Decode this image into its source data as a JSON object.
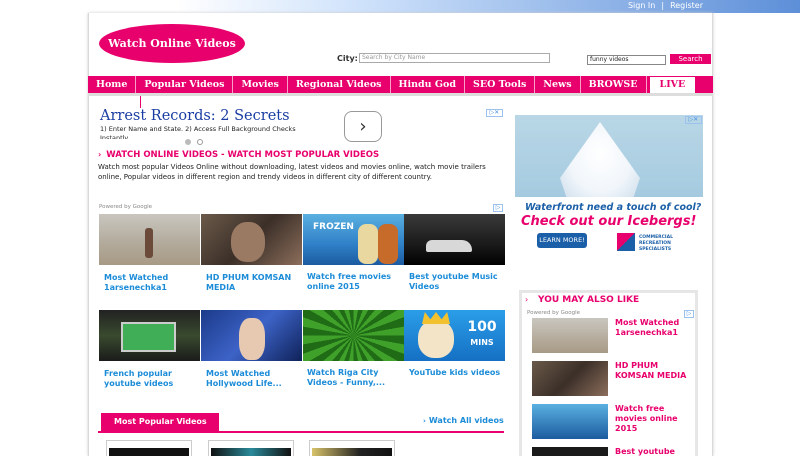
{
  "header": {
    "sign_in": "Sign In",
    "separator": "|",
    "register": "Register",
    "logo_text": "Watch Online Videos",
    "city_label": "City:",
    "city_placeholder": "Search by City Name",
    "search_value": "funny videos",
    "search_button": "Search"
  },
  "nav": {
    "items": [
      "Home",
      "Popular Videos",
      "Movies",
      "Regional Videos",
      "Hindu God",
      "SEO Tools",
      "News",
      "BROWSE"
    ],
    "live": "LIVE"
  },
  "ad_top": {
    "title": "Arrest Records: 2 Secrets",
    "text": "1) Enter Name and State. 2) Access Full Background Checks Instantly.",
    "arrow": "›"
  },
  "main": {
    "section_title": "WATCH ONLINE VIDEOS - WATCH MOST POPULAR VIDEOS",
    "caret": "›",
    "description": "Watch most popular Videos Online without downloading, latest videos and movies online, watch movie trailers online, Popular videos in different region and trendy videos in different city of different country.",
    "powered_by": "Powered by Google",
    "videos": [
      {
        "title": "Most Watched 1arsenechka1"
      },
      {
        "title": "HD PHUM KOMSAN MEDIA"
      },
      {
        "title": "Watch free movies online 2015"
      },
      {
        "title": "Best youtube Music Videos"
      },
      {
        "title": "French popular youtube videos"
      },
      {
        "title": "Most Watched Hollywood Life..."
      },
      {
        "title": "Watch Riga City Videos - Funny,..."
      },
      {
        "title": "YouTube kids videos"
      }
    ],
    "thumb_badge": "100\nMINS",
    "popular_tab": "Most Popular Videos",
    "watch_all": "Watch All videos"
  },
  "right_ad": {
    "line1": "Waterfront need a touch of cool?",
    "line2": "Check out our Icebergs!",
    "button": "LEARN MORE!",
    "company": "COMMERCIAL RECREATION SPECIALISTS"
  },
  "sidebar": {
    "heading": "YOU MAY ALSO LIKE",
    "powered_by": "Powered by Google",
    "items": [
      {
        "title": "Most Watched 1arsenechka1"
      },
      {
        "title": "HD PHUM KOMSAN MEDIA"
      },
      {
        "title": "Watch free movies online 2015"
      },
      {
        "title": "Best youtube"
      }
    ]
  },
  "colors": {
    "accent": "#e8006c",
    "link": "#1c8cd8"
  }
}
